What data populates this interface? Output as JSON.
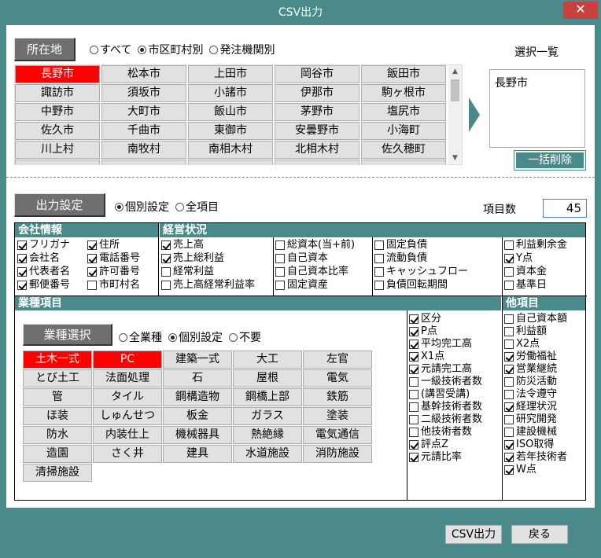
{
  "window": {
    "title": "CSV出力",
    "close_label": "✕"
  },
  "location": {
    "label": "所在地",
    "radios": [
      {
        "label": "すべて",
        "selected": false
      },
      {
        "label": "市区町村別",
        "selected": true
      },
      {
        "label": "発注機関別",
        "selected": false
      }
    ],
    "cities": [
      [
        "長野市",
        "松本市",
        "上田市",
        "岡谷市",
        "飯田市"
      ],
      [
        "諏訪市",
        "須坂市",
        "小諸市",
        "伊那市",
        "駒ヶ根市"
      ],
      [
        "中野市",
        "大町市",
        "飯山市",
        "茅野市",
        "塩尻市"
      ],
      [
        "佐久市",
        "千曲市",
        "東御市",
        "安曇野市",
        "小海町"
      ],
      [
        "川上村",
        "南牧村",
        "南相木村",
        "北相木村",
        "佐久穂町"
      ]
    ],
    "selected_city": "長野市",
    "selection_title": "選択一覧",
    "selection_list": [
      "長野市"
    ],
    "clear_all_label": "一括削除"
  },
  "output": {
    "label": "出力設定",
    "radios": [
      {
        "label": "個別設定",
        "selected": true
      },
      {
        "label": "全項目",
        "selected": false
      }
    ],
    "count_label": "項目数",
    "count_value": "45"
  },
  "company": {
    "title": "会社情報",
    "col1": [
      {
        "label": "フリガナ",
        "checked": true
      },
      {
        "label": "会社名",
        "checked": true
      },
      {
        "label": "代表者名",
        "checked": true
      },
      {
        "label": "郵便番号",
        "checked": true
      }
    ],
    "col2": [
      {
        "label": "住所",
        "checked": true
      },
      {
        "label": "電話番号",
        "checked": true
      },
      {
        "label": "許可番号",
        "checked": true
      },
      {
        "label": "市町村名",
        "checked": false
      }
    ]
  },
  "management": {
    "title": "経営状況",
    "col1": [
      {
        "label": "売上高",
        "checked": true
      },
      {
        "label": "売上総利益",
        "checked": true
      },
      {
        "label": "経常利益",
        "checked": false
      },
      {
        "label": "売上高経常利益率",
        "checked": false
      }
    ],
    "col2": [
      {
        "label": "総資本(当+前)",
        "checked": false
      },
      {
        "label": "自己資本",
        "checked": false
      },
      {
        "label": "自己資本比率",
        "checked": false
      },
      {
        "label": "固定資産",
        "checked": false
      }
    ],
    "col3": [
      {
        "label": "固定負債",
        "checked": false
      },
      {
        "label": "流動負債",
        "checked": false
      },
      {
        "label": "キャッシュフロー",
        "checked": false
      },
      {
        "label": "負債回転期間",
        "checked": false
      }
    ],
    "col4": [
      {
        "label": "利益剰余金",
        "checked": false
      },
      {
        "label": "Y点",
        "checked": true
      },
      {
        "label": "資本金",
        "checked": false
      },
      {
        "label": "基準日",
        "checked": false
      }
    ]
  },
  "industry": {
    "title": "業種項目",
    "select_label": "業種選択",
    "radios": [
      {
        "label": "全業種",
        "selected": false
      },
      {
        "label": "個別設定",
        "selected": true
      },
      {
        "label": "不要",
        "selected": false
      }
    ],
    "types": [
      [
        "土木一式",
        "PC",
        "建築一式",
        "大工",
        "左官"
      ],
      [
        "とび土工",
        "法面処理",
        "石",
        "屋根",
        "電気"
      ],
      [
        "管",
        "タイル",
        "鋼構造物",
        "鋼橋上部",
        "鉄筋"
      ],
      [
        "ほ装",
        "しゅんせつ",
        "板金",
        "ガラス",
        "塗装"
      ],
      [
        "防水",
        "内装仕上",
        "機械器具",
        "熱絶縁",
        "電気通信"
      ],
      [
        "造園",
        "さく井",
        "建具",
        "水道施設",
        "消防施設"
      ],
      [
        "清掃施設"
      ]
    ],
    "selected_types": [
      "土木一式",
      "PC"
    ],
    "items": [
      {
        "label": "区分",
        "checked": true
      },
      {
        "label": "P点",
        "checked": true
      },
      {
        "label": "平均完工高",
        "checked": true
      },
      {
        "label": "X1点",
        "checked": true
      },
      {
        "label": "元請完工高",
        "checked": true
      },
      {
        "label": "一級技術者数",
        "checked": false
      },
      {
        "label": "(講習受講)",
        "checked": false
      },
      {
        "label": "基幹技術者数",
        "checked": false
      },
      {
        "label": "二級技術者数",
        "checked": false
      },
      {
        "label": "他技術者数",
        "checked": false
      },
      {
        "label": "評点Z",
        "checked": true
      },
      {
        "label": "元請比率",
        "checked": true
      }
    ]
  },
  "other": {
    "title": "他項目",
    "items": [
      {
        "label": "自己資本額",
        "checked": false
      },
      {
        "label": "利益額",
        "checked": false
      },
      {
        "label": "X2点",
        "checked": false
      },
      {
        "label": "労働福祉",
        "checked": true
      },
      {
        "label": "営業継続",
        "checked": true
      },
      {
        "label": "防災活動",
        "checked": false
      },
      {
        "label": "法令遵守",
        "checked": false
      },
      {
        "label": "経理状況",
        "checked": true
      },
      {
        "label": "研究開発",
        "checked": false
      },
      {
        "label": "建設機械",
        "checked": false
      },
      {
        "label": "ISO取得",
        "checked": true
      },
      {
        "label": "若年技術者",
        "checked": true
      },
      {
        "label": "W点",
        "checked": true
      }
    ]
  },
  "footer": {
    "csv_label": "CSV出力",
    "back_label": "戻る"
  }
}
